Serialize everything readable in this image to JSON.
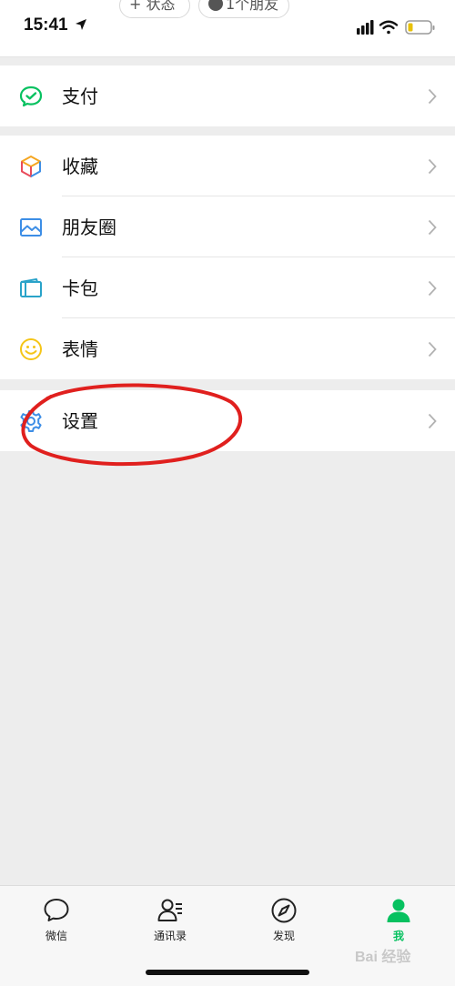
{
  "status_bar": {
    "time": "15:41",
    "status_pill": "+ 状态",
    "friends_pill": "1个朋友"
  },
  "menu": {
    "pay": {
      "label": "支付",
      "icon": "wechat-pay-icon"
    },
    "favorites": {
      "label": "收藏",
      "icon": "cube-icon"
    },
    "moments": {
      "label": "朋友圈",
      "icon": "image-icon"
    },
    "cards": {
      "label": "卡包",
      "icon": "wallet-icon"
    },
    "stickers": {
      "label": "表情",
      "icon": "smiley-icon"
    },
    "settings": {
      "label": "设置",
      "icon": "gear-icon"
    }
  },
  "tabs": [
    {
      "label": "微信",
      "icon": "chat-bubble-icon"
    },
    {
      "label": "通讯录",
      "icon": "contacts-icon"
    },
    {
      "label": "发现",
      "icon": "compass-icon"
    },
    {
      "label": "我",
      "icon": "person-icon",
      "active": true
    }
  ],
  "watermark": "Bai 经验",
  "colors": {
    "accent_green": "#07c160",
    "annotation_red": "#e0201e",
    "background": "#ededed"
  }
}
